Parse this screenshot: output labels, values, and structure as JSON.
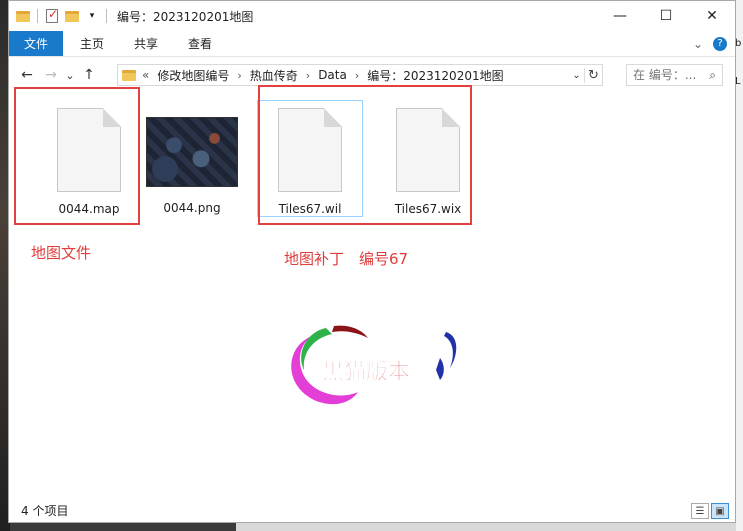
{
  "window": {
    "title": "编号：2023120201地图",
    "controls": {
      "minimize": "—",
      "maximize": "☐",
      "close": "✕"
    }
  },
  "ribbon": {
    "tabs": [
      "文件",
      "主页",
      "共享",
      "查看"
    ],
    "expand_icon": "chevron-down-icon",
    "help_icon": "?"
  },
  "nav": {
    "back": "←",
    "forward": "→",
    "recent": "⌄",
    "up": "↑",
    "breadcrumb": [
      "修改地图编号",
      "热血传奇",
      "Data",
      "编号：2023120201地图"
    ],
    "overflow": "«",
    "refresh": "↻",
    "search_placeholder": "在 编号：..."
  },
  "files": [
    {
      "name": "0044.map",
      "type": "document"
    },
    {
      "name": "0044.png",
      "type": "image"
    },
    {
      "name": "Tiles67.wil",
      "type": "document",
      "selected": true
    },
    {
      "name": "Tiles67.wix",
      "type": "document"
    }
  ],
  "annotations": {
    "map_note": "地图文件",
    "patch_note": "地图补丁　编号67"
  },
  "logo": {
    "text": "黑猫版本"
  },
  "status": {
    "count": "4 个项目"
  },
  "background": {
    "right_edge_chars": [
      "b",
      "L"
    ]
  }
}
